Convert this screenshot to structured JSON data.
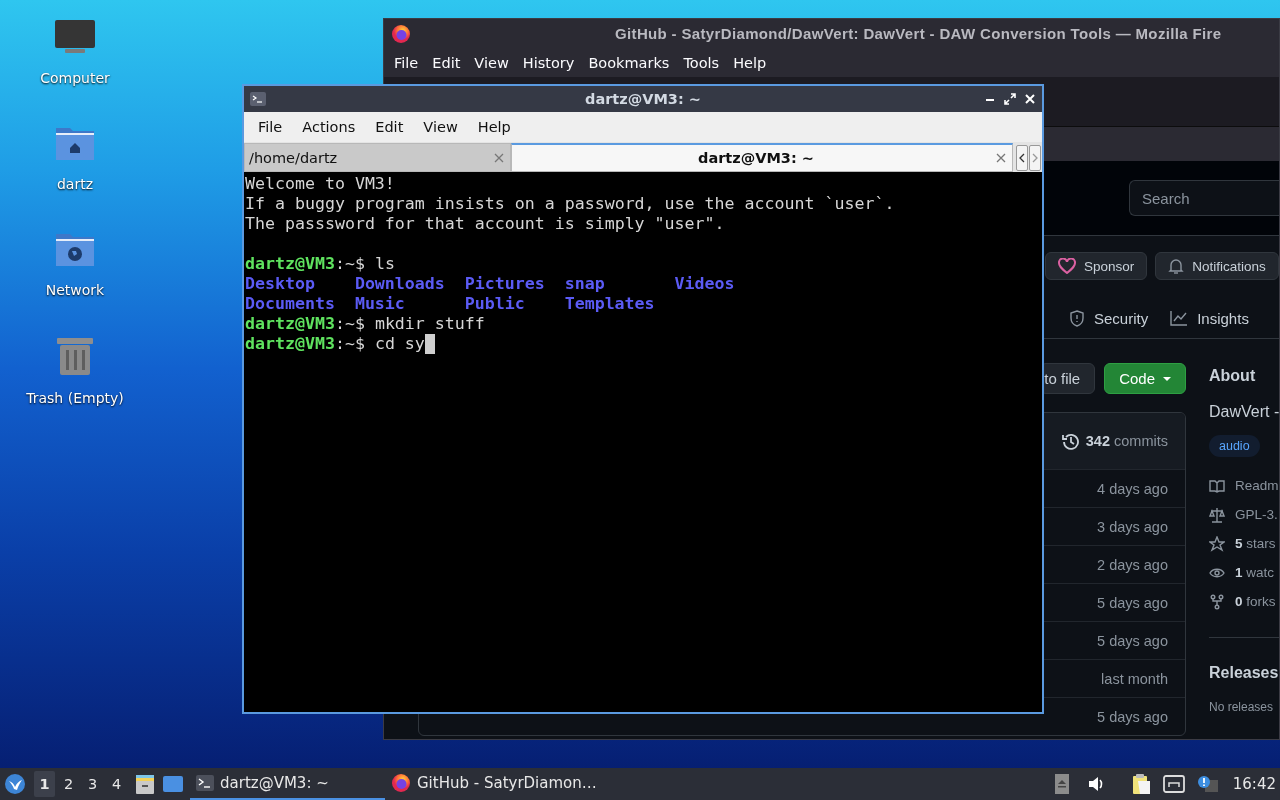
{
  "desktop_icons": [
    {
      "label": "Computer",
      "kind": "computer"
    },
    {
      "label": "dartz",
      "kind": "home"
    },
    {
      "label": "Network",
      "kind": "network"
    },
    {
      "label": "Trash (Empty)",
      "kind": "trash"
    }
  ],
  "browser": {
    "title": "GitHub - SatyrDiamond/DawVert: DawVert - DAW Conversion Tools — Mozilla Fire",
    "menu": [
      "File",
      "Edit",
      "View",
      "History",
      "Bookmarks",
      "Tools",
      "Help"
    ],
    "search": {
      "placeholder": "Search"
    },
    "repo_buttons": [
      {
        "label": "Sponsor",
        "kind": "sponsor"
      },
      {
        "label": "Notifications",
        "kind": "bell"
      }
    ],
    "repo_tabs": [
      {
        "label": "Security",
        "kind": "shield"
      },
      {
        "label": "Insights",
        "kind": "graph"
      }
    ],
    "file_buttons": [
      {
        "label": "to file",
        "kind": "plain"
      },
      {
        "label": "Code",
        "kind": "primary"
      }
    ],
    "commits": {
      "count": "342",
      "label": "commits"
    },
    "file_rows": [
      {
        "time": "4 days ago"
      },
      {
        "time": "3 days ago"
      },
      {
        "time": "2 days ago"
      },
      {
        "time": "5 days ago"
      },
      {
        "time": "5 days ago"
      },
      {
        "time": "last month"
      },
      {
        "time": "5 days ago"
      }
    ],
    "about": {
      "heading": "About",
      "description": "DawVert -",
      "topics": [
        "audio"
      ],
      "facts": [
        {
          "kind": "book",
          "text": "Readm"
        },
        {
          "kind": "law",
          "text": "GPL-3."
        },
        {
          "kind": "star",
          "count": "5",
          "text": "stars"
        },
        {
          "kind": "eye",
          "count": "1",
          "text": "watc"
        },
        {
          "kind": "fork",
          "count": "0",
          "text": "forks"
        }
      ],
      "releases_heading": "Releases",
      "releases_note": "No releases"
    }
  },
  "terminal": {
    "title": "dartz@VM3: ~",
    "menu": [
      "File",
      "Actions",
      "Edit",
      "View",
      "Help"
    ],
    "tabs": [
      {
        "label": "/home/dartz",
        "selected": false
      },
      {
        "label": "dartz@VM3: ~",
        "selected": true
      }
    ],
    "lines": [
      {
        "kind": "text",
        "text": "Welcome to VM3!"
      },
      {
        "kind": "text",
        "text": "If a buggy program insists on a password, use the account `user`."
      },
      {
        "kind": "text",
        "text": "The passsword for that account is simply \"user\"."
      },
      {
        "kind": "blank"
      },
      {
        "kind": "prompt",
        "user": "dartz@VM3",
        "rest": ":~$",
        "command": "ls"
      },
      {
        "kind": "listing",
        "rows": [
          [
            "Desktop",
            "Downloads",
            "Pictures",
            "snap",
            "Videos"
          ],
          [
            "Documents",
            "Music",
            "Public",
            "Templates"
          ]
        ]
      },
      {
        "kind": "prompt",
        "user": "dartz@VM3",
        "rest": ":~$",
        "command": "mkdir stuff"
      },
      {
        "kind": "prompt",
        "user": "dartz@VM3",
        "rest": ":~$",
        "command": "cd sy",
        "cursor": true
      }
    ]
  },
  "taskbar": {
    "workspaces": [
      {
        "label": "1",
        "selected": true
      },
      {
        "label": "2",
        "selected": false
      },
      {
        "label": "3",
        "selected": false
      },
      {
        "label": "4",
        "selected": false
      }
    ],
    "tasks": [
      {
        "label": "dartz@VM3: ~",
        "kind": "terminal",
        "selected": true
      },
      {
        "label": "GitHub - SatyrDiamon…",
        "kind": "firefox",
        "selected": false
      }
    ],
    "clock": "16:42"
  }
}
